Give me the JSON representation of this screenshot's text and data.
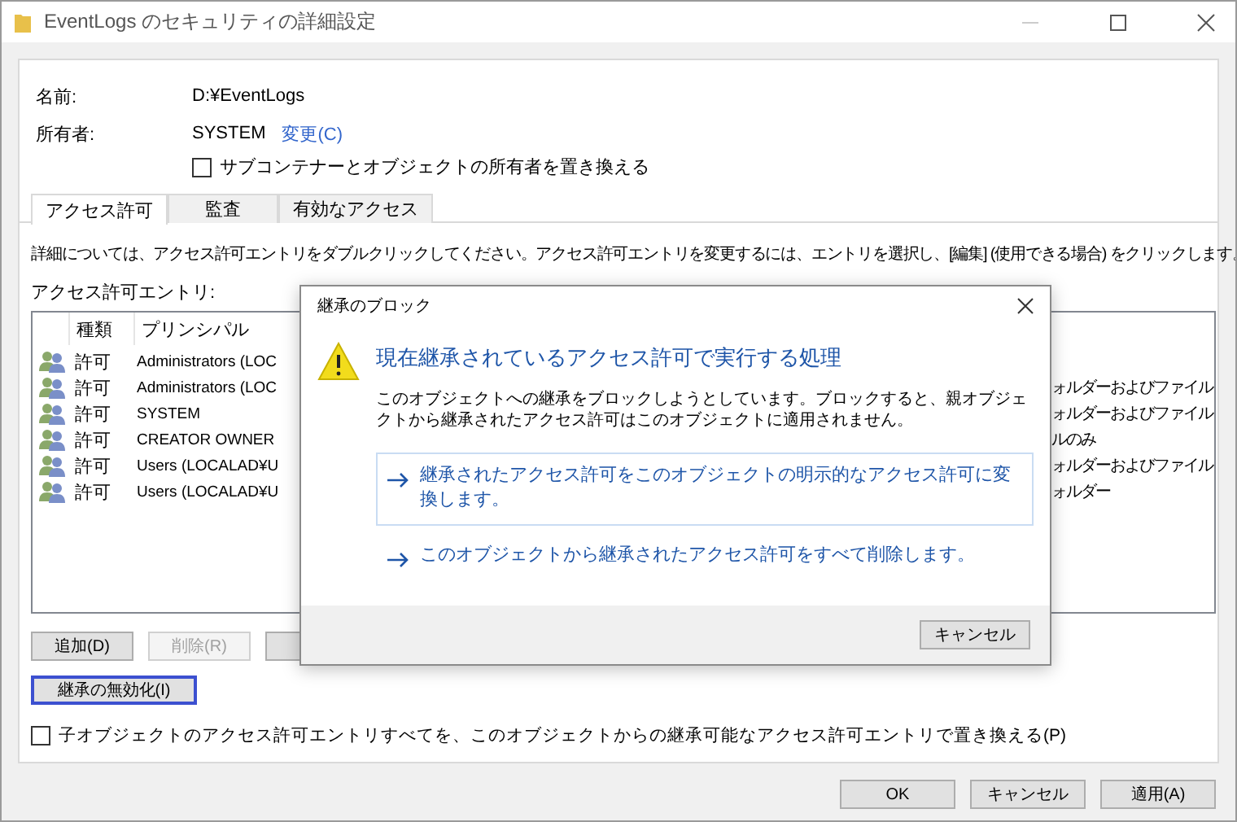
{
  "window": {
    "title": "EventLogs のセキュリティの詳細設定"
  },
  "properties": [
    {
      "label": "名前:",
      "value": "D:¥EventLogs"
    },
    {
      "label": "所有者:",
      "value": "SYSTEM",
      "link": "変更(C)"
    }
  ],
  "replace_owner": {
    "label": "サブコンテナーとオブジェクトの所有者を置き換える",
    "checked": false
  },
  "tabs": [
    {
      "label": "アクセス許可",
      "selected": true
    },
    {
      "label": "監査",
      "selected": false
    },
    {
      "label": "有効なアクセス",
      "selected": false
    }
  ],
  "description": "詳細については、アクセス許可エントリをダブルクリックしてください。アクセス許可エントリを変更するには、エントリを選択し、[編集] (使用できる場合) をクリックします。",
  "entries_label": "アクセス許可エントリ:",
  "table": {
    "columns": [
      "種類",
      "プリンシパル"
    ],
    "rows": [
      {
        "type": "許可",
        "principal": "Administrators (LOC"
      },
      {
        "type": "許可",
        "principal": "Administrators (LOC",
        "applies_to": "ォルダーおよびファイル"
      },
      {
        "type": "許可",
        "principal": "SYSTEM",
        "applies_to": "ォルダーおよびファイル"
      },
      {
        "type": "許可",
        "principal": "CREATOR OWNER",
        "applies_to": "ルのみ"
      },
      {
        "type": "許可",
        "principal": "Users (LOCALAD¥U",
        "applies_to": "ォルダーおよびファイル"
      },
      {
        "type": "許可",
        "principal": "Users (LOCALAD¥U",
        "applies_to": "ォルダー"
      }
    ]
  },
  "entry_buttons": [
    {
      "label": "追加(D)",
      "disabled": false
    },
    {
      "label": "削除(R)",
      "disabled": true
    },
    {
      "disabled": false
    }
  ],
  "disable_inheritance_button": {
    "label": "継承の無効化(I)",
    "focused": true
  },
  "replace_children": {
    "label": "子オブジェクトのアクセス許可エントリすべてを、このオブジェクトからの継承可能なアクセス許可エントリで置き換える(P)",
    "checked": false
  },
  "footer_buttons": [
    {
      "label": "OK"
    },
    {
      "label": "キャンセル"
    },
    {
      "label": "適用(A)"
    }
  ],
  "dialog": {
    "title": "継承のブロック",
    "heading": "現在継承されているアクセス許可で実行する処理",
    "description": "このオブジェクトへの継承をブロックしようとしています。ブロックすると、親オブジェクトから継承されたアクセス許可はこのオブジェクトに適用されません。",
    "options": [
      {
        "text": "継承されたアクセス許可をこのオブジェクトの明示的なアクセス許可に変換します。",
        "highlighted": true
      },
      {
        "text": "このオブジェクトから継承されたアクセス許可をすべて削除します。",
        "highlighted": false
      }
    ],
    "cancel": "キャンセル"
  }
}
